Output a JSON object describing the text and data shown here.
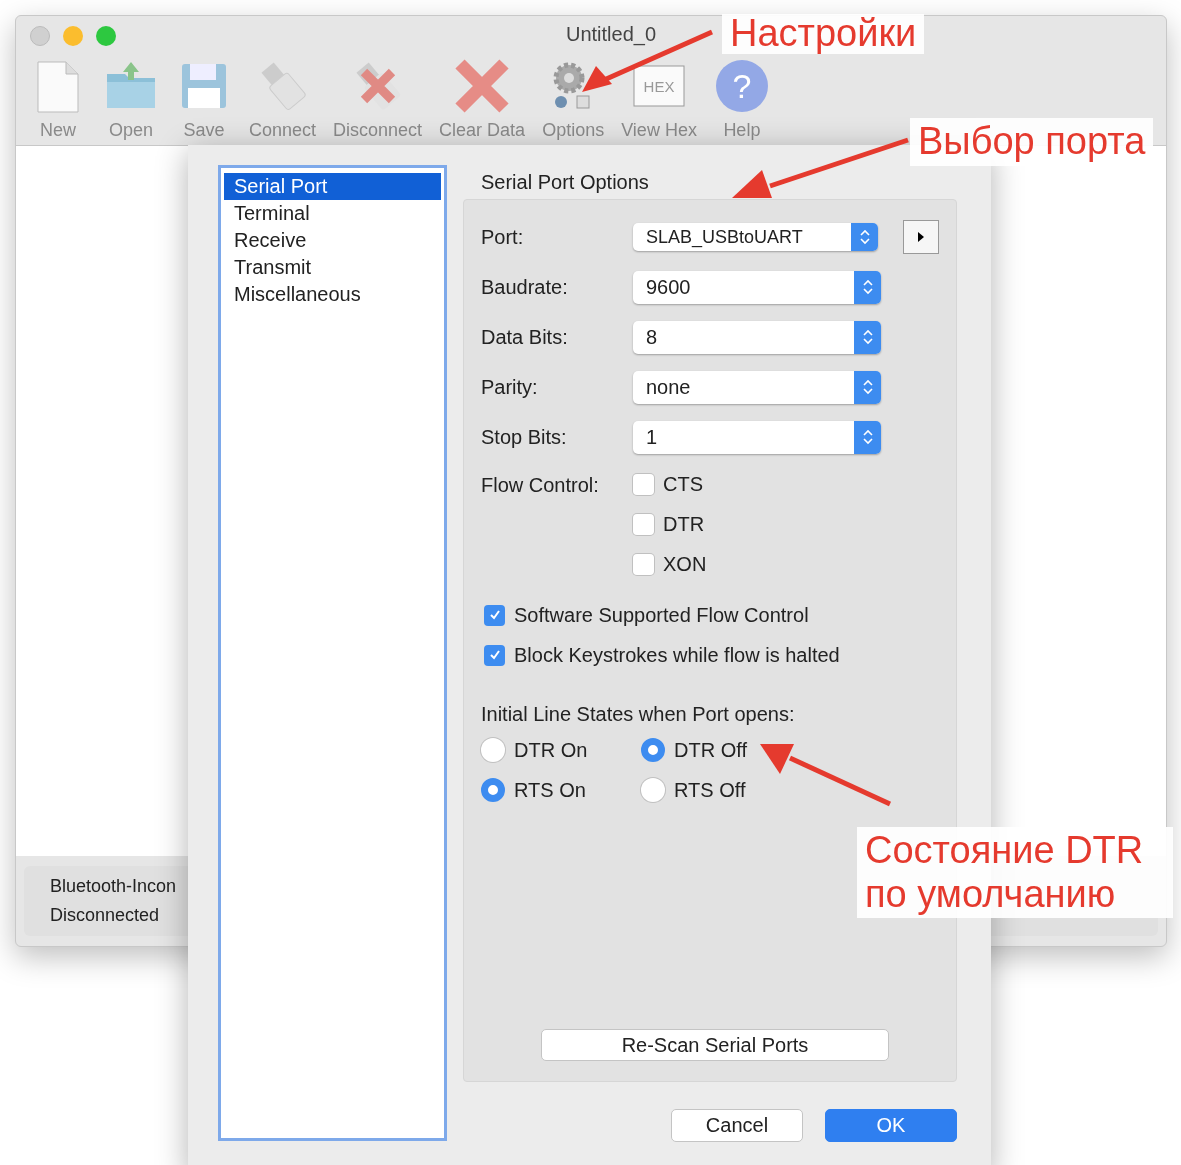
{
  "window": {
    "title": "Untitled_0"
  },
  "toolbar": [
    {
      "kind": "new",
      "label": "New"
    },
    {
      "kind": "open",
      "label": "Open"
    },
    {
      "kind": "save",
      "label": "Save"
    },
    {
      "kind": "connect",
      "label": "Connect"
    },
    {
      "kind": "disconnect",
      "label": "Disconnect"
    },
    {
      "kind": "clear",
      "label": "Clear Data"
    },
    {
      "kind": "options",
      "label": "Options"
    },
    {
      "kind": "hex",
      "label": "View Hex",
      "icon_text": "HEX"
    },
    {
      "kind": "help",
      "label": "Help",
      "icon_text": "?"
    }
  ],
  "status_bar": {
    "device": "Bluetooth-Incon",
    "state": "Disconnected"
  },
  "dialog": {
    "sidebar": [
      {
        "label": "Serial Port",
        "selected": true
      },
      {
        "label": "Terminal",
        "selected": false
      },
      {
        "label": "Receive",
        "selected": false
      },
      {
        "label": "Transmit",
        "selected": false
      },
      {
        "label": "Miscellaneous",
        "selected": false
      }
    ],
    "section_title": "Serial Port Options",
    "selects": [
      {
        "label": "Port:",
        "value": "SLAB_USBtoUART"
      },
      {
        "label": "Baudrate:",
        "value": "9600"
      },
      {
        "label": "Data Bits:",
        "value": "8"
      },
      {
        "label": "Parity:",
        "value": "none"
      },
      {
        "label": "Stop Bits:",
        "value": "1"
      }
    ],
    "flow_control": {
      "label": "Flow Control:",
      "options": [
        {
          "label": "CTS",
          "checked": false
        },
        {
          "label": "DTR",
          "checked": false
        },
        {
          "label": "XON",
          "checked": false
        }
      ]
    },
    "checkboxes": [
      {
        "label": "Software Supported Flow Control",
        "checked": true
      },
      {
        "label": "Block Keystrokes while flow is halted",
        "checked": true
      }
    ],
    "line_states": {
      "heading": "Initial Line States when Port opens:",
      "radios": [
        {
          "label": "DTR On",
          "selected": false
        },
        {
          "label": "DTR Off",
          "selected": true
        },
        {
          "label": "RTS On",
          "selected": true
        },
        {
          "label": "RTS Off",
          "selected": false
        }
      ]
    },
    "rescan_button": "Re-Scan Serial Ports",
    "buttons": [
      {
        "label": "Cancel",
        "default": false
      },
      {
        "label": "OK",
        "default": true
      }
    ]
  },
  "annotations": [
    {
      "text": "Настройки"
    },
    {
      "text": "Выбор порта"
    },
    {
      "text": "Состояние DTR по умолчанию"
    }
  ]
}
